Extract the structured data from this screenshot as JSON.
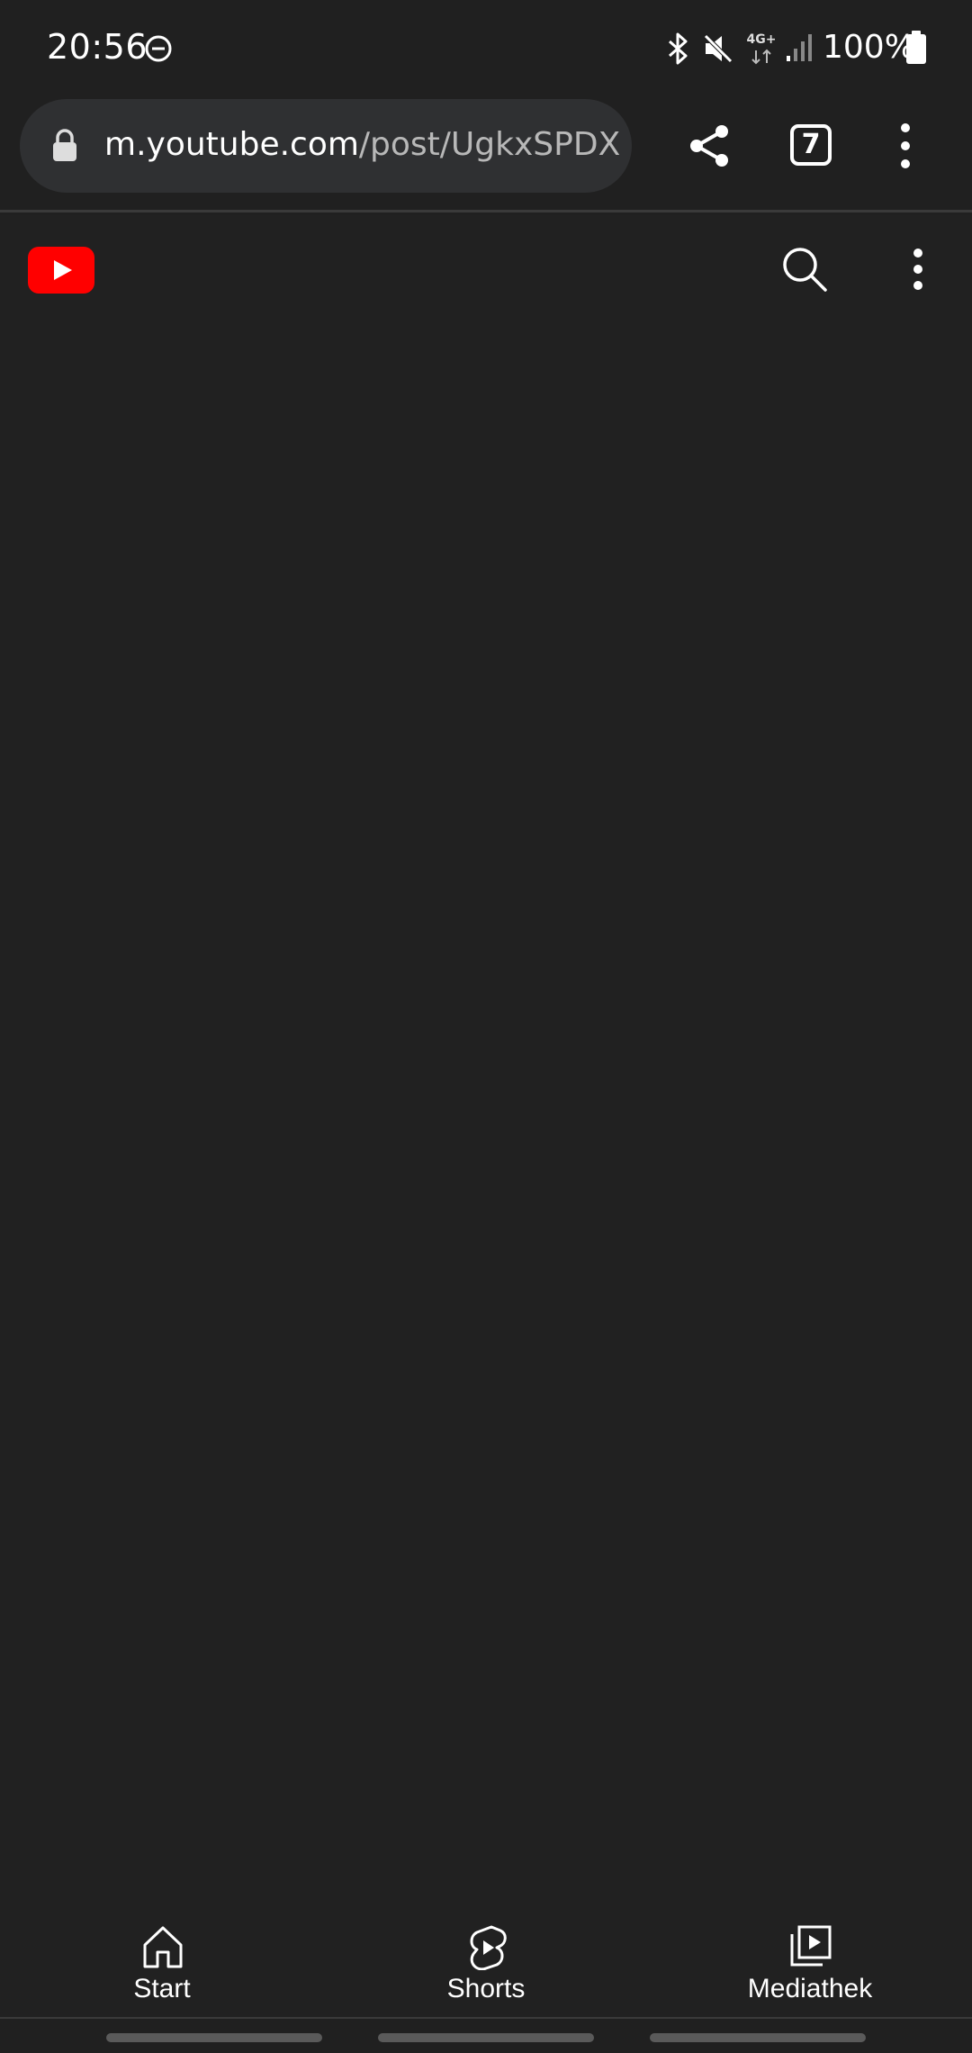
{
  "status_bar": {
    "time": "20:56",
    "network": "4G+",
    "battery": "100%"
  },
  "browser": {
    "url_domain": "m.youtube.com",
    "url_path": "/post/UgkxSPDXTO",
    "tab_count": "7"
  },
  "youtube": {
    "logo_color": "#ff0000"
  },
  "bottom_nav": {
    "items": [
      {
        "label": "Start",
        "icon": "home-icon"
      },
      {
        "label": "Shorts",
        "icon": "shorts-icon"
      },
      {
        "label": "Mediathek",
        "icon": "library-icon"
      }
    ]
  }
}
